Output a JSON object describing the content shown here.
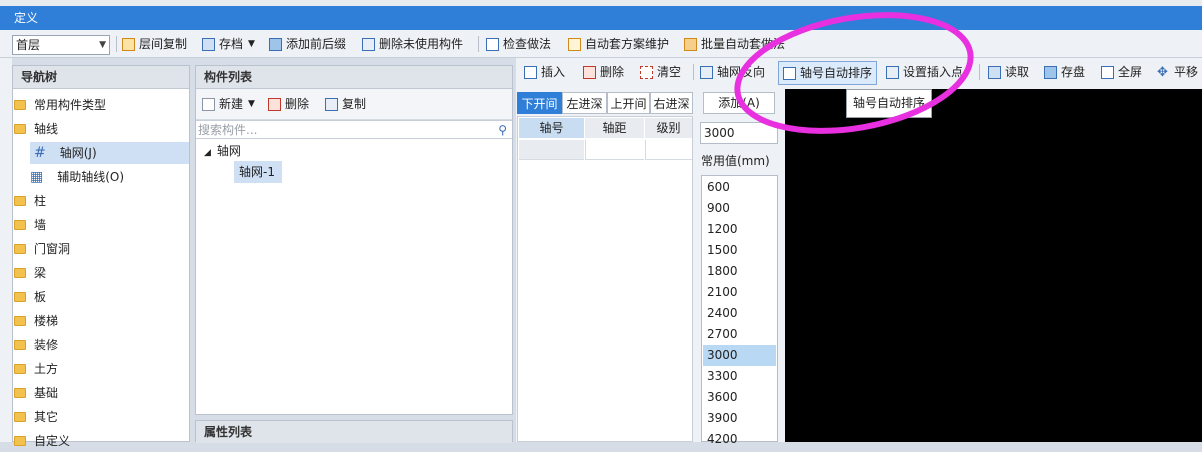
{
  "window": {
    "title": "定义"
  },
  "toolbar": {
    "floor_value": "首层",
    "items": [
      {
        "label": "层间复制",
        "icon": "copy-floor-icon"
      },
      {
        "label": "存档",
        "icon": "archive-icon"
      },
      {
        "label": "添加前后缀",
        "icon": "add-prefix-icon"
      },
      {
        "label": "删除未使用构件",
        "icon": "delete-unused-icon"
      },
      {
        "label": "检查做法",
        "icon": "check-method-icon"
      },
      {
        "label": "自动套方案维护",
        "icon": "auto-scheme-icon"
      },
      {
        "label": "批量自动套做法",
        "icon": "batch-auto-icon"
      }
    ]
  },
  "nav": {
    "title": "导航树",
    "items": [
      {
        "label": "常用构件类型"
      },
      {
        "label": "轴线"
      },
      {
        "label": "轴网(J)"
      },
      {
        "label": "辅助轴线(O)"
      },
      {
        "label": "柱"
      },
      {
        "label": "墙"
      },
      {
        "label": "门窗洞"
      },
      {
        "label": "梁"
      },
      {
        "label": "板"
      },
      {
        "label": "楼梯"
      },
      {
        "label": "装修"
      },
      {
        "label": "土方"
      },
      {
        "label": "基础"
      },
      {
        "label": "其它"
      },
      {
        "label": "自定义"
      }
    ]
  },
  "components": {
    "title": "构件列表",
    "new_label": "新建",
    "delete_label": "删除",
    "copy_label": "复制",
    "search_placeholder": "搜索构件...",
    "tree_root": "轴网",
    "tree_child": "轴网-1",
    "props_title": "属性列表"
  },
  "axis_toolbar": {
    "items": [
      {
        "label": "插入",
        "icon": "insert-icon"
      },
      {
        "label": "删除",
        "icon": "delete-icon"
      },
      {
        "label": "清空",
        "icon": "clear-icon"
      },
      {
        "label": "轴网反向",
        "icon": "reverse-icon"
      },
      {
        "label": "轴号自动排序",
        "icon": "auto-sort-icon"
      },
      {
        "label": "设置插入点",
        "icon": "set-insert-icon"
      },
      {
        "label": "读取",
        "icon": "read-icon"
      },
      {
        "label": "存盘",
        "icon": "save-icon"
      },
      {
        "label": "全屏",
        "icon": "fullscreen-icon"
      },
      {
        "label": "平移",
        "icon": "pan-icon"
      }
    ],
    "tooltip": "轴号自动排序"
  },
  "axis_tabs": [
    "下开间",
    "左进深",
    "上开间",
    "右进深"
  ],
  "axis_table": {
    "headers": [
      "轴号",
      "轴距",
      "级别"
    ]
  },
  "add_button": "添加(A)",
  "distance_input": "3000",
  "common_values": {
    "title": "常用值(mm)",
    "items": [
      "600",
      "900",
      "1200",
      "1500",
      "1800",
      "2100",
      "2400",
      "2700",
      "3000",
      "3300",
      "3600",
      "3900",
      "4200"
    ],
    "selected": "3000"
  },
  "colors": {
    "titlebar": "#2f7ed8",
    "highlight": "#e830e0",
    "selection": "#b8d8f4"
  }
}
